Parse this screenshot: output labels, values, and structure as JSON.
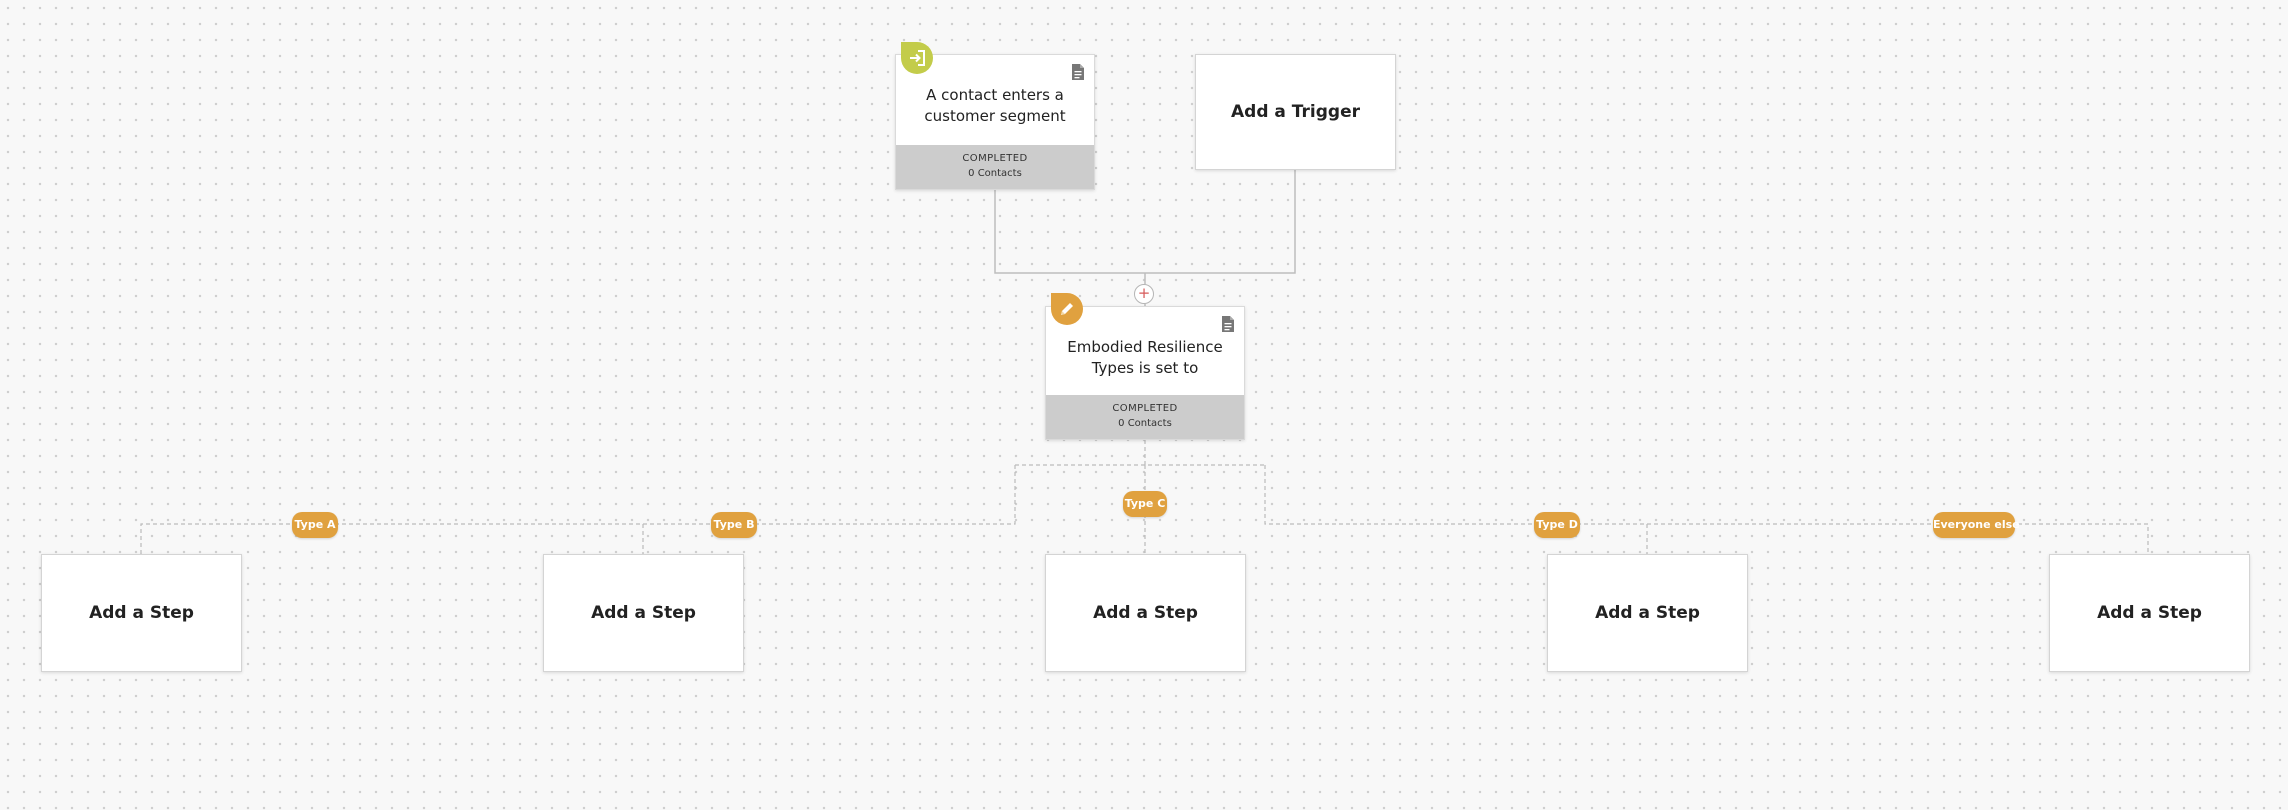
{
  "workflow": {
    "entry_node": {
      "title": "A contact enters a customer segment",
      "status": "COMPLETED",
      "contacts": "0 Contacts",
      "icon": "enter-segment-icon",
      "icon_color": "#c3cc4a"
    },
    "add_trigger": {
      "label": "Add a Trigger"
    },
    "add_node_button": {
      "label": "+"
    },
    "condition_node": {
      "title": "Embodied Resilience Types is set to",
      "status": "COMPLETED",
      "contacts": "0 Contacts",
      "icon": "pencil-icon",
      "icon_color": "#e0a13f"
    },
    "branches": [
      {
        "label": "Type A",
        "step_label": "Add a Step"
      },
      {
        "label": "Type B",
        "step_label": "Add a Step"
      },
      {
        "label": "Type C",
        "step_label": "Add a Step"
      },
      {
        "label": "Type D",
        "step_label": "Add a Step"
      },
      {
        "label": "Everyone else",
        "step_label": "Add a Step"
      }
    ]
  },
  "colors": {
    "branch_pill": "#e0a13f",
    "footer_gray": "#cccccc",
    "add_plus": "#d65a5a"
  }
}
